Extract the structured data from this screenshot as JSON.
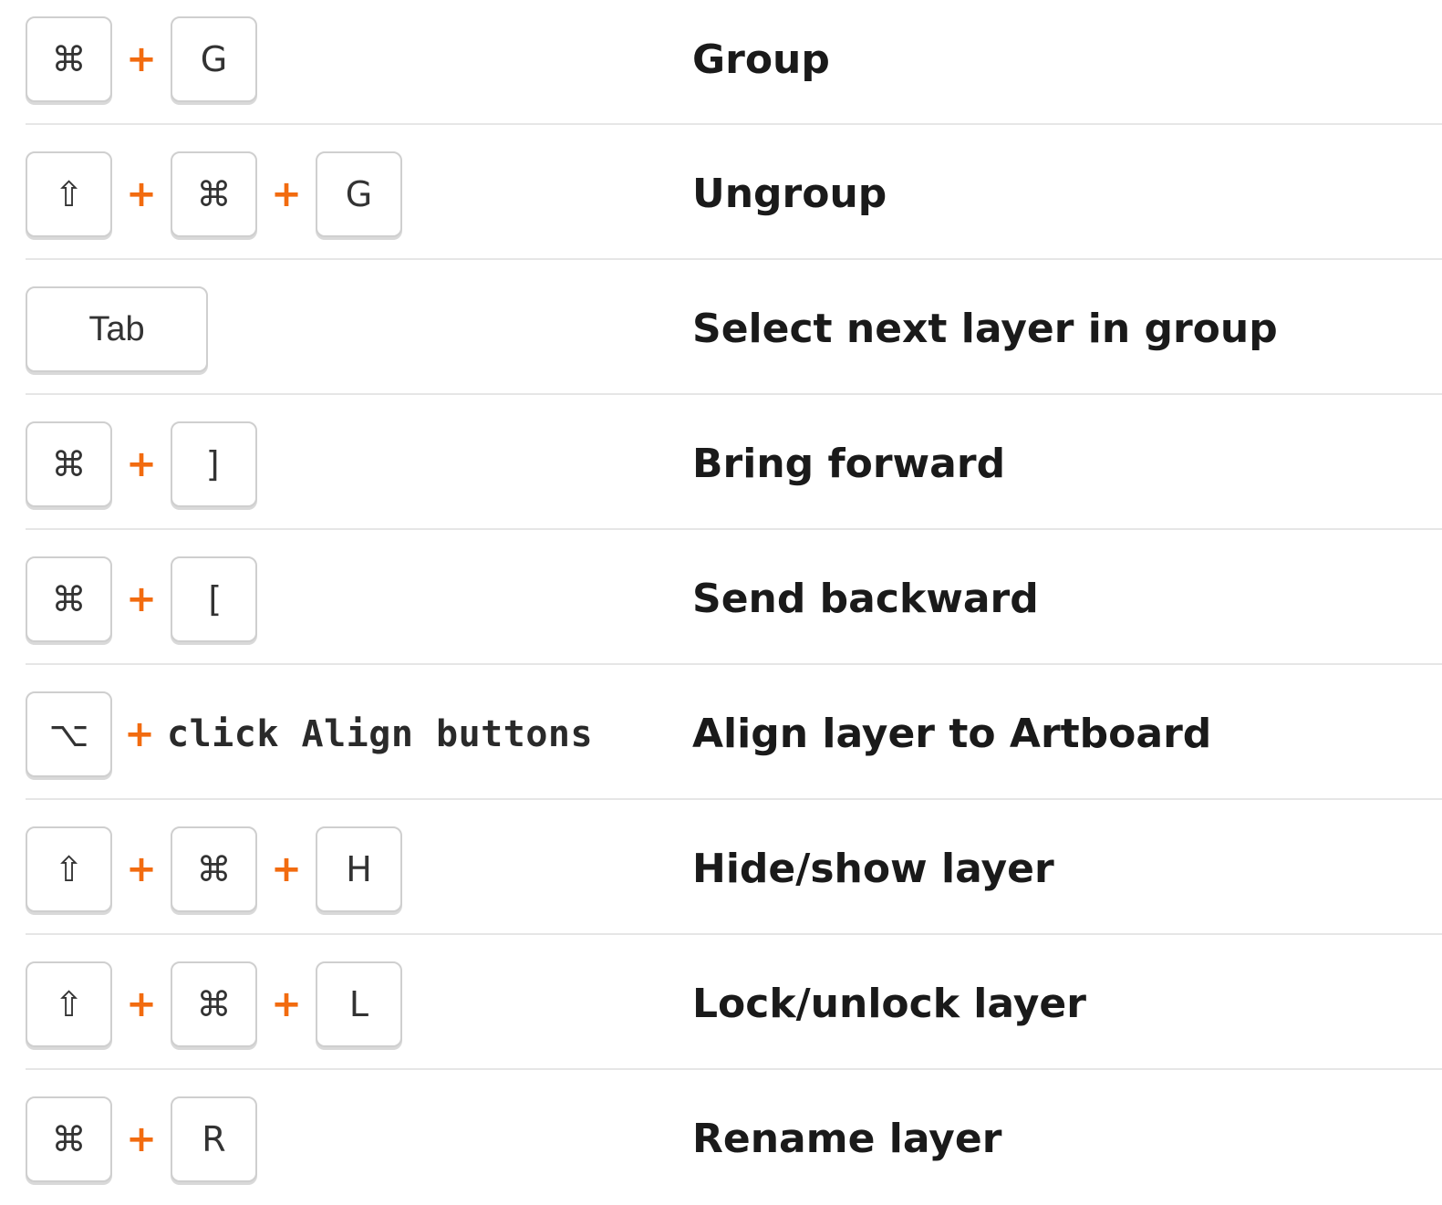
{
  "shortcuts": [
    {
      "keys": [
        "⌘",
        "G"
      ],
      "description": "Group"
    },
    {
      "keys": [
        "⇧",
        "⌘",
        "G"
      ],
      "description": "Ungroup"
    },
    {
      "keys": [
        "Tab"
      ],
      "description": "Select next layer in group"
    },
    {
      "keys": [
        "⌘",
        "]"
      ],
      "description": "Bring forward"
    },
    {
      "keys": [
        "⌘",
        "["
      ],
      "description": "Send backward"
    },
    {
      "keys": [
        "⌥"
      ],
      "extra_text": "click Align buttons",
      "description": "Align layer to Artboard"
    },
    {
      "keys": [
        "⇧",
        "⌘",
        "H"
      ],
      "description": "Hide/show layer"
    },
    {
      "keys": [
        "⇧",
        "⌘",
        "L"
      ],
      "description": "Lock/unlock layer"
    },
    {
      "keys": [
        "⌘",
        "R"
      ],
      "description": "Rename layer"
    }
  ],
  "separator": "+",
  "colors": {
    "plus": "#f26b0f",
    "key_border": "#cfcfcf",
    "divider": "#e6e6e6",
    "text": "#1a1a1a"
  },
  "icons": {
    "command": "command-icon",
    "shift": "shift-icon",
    "option": "option-icon"
  }
}
